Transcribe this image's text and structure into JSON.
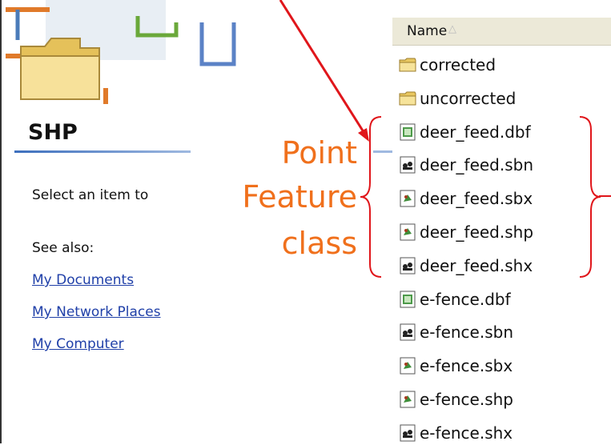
{
  "left": {
    "folder_title": "SHP",
    "select_text": "Select an item to",
    "see_also": "See also:",
    "links": [
      "My Documents",
      "My Network Places",
      "My Computer"
    ]
  },
  "list": {
    "column_name": "Name",
    "sort_icon": "sort-ascending-icon",
    "files": [
      {
        "name": "corrected",
        "icon": "folder-icon"
      },
      {
        "name": "uncorrected",
        "icon": "folder-icon"
      },
      {
        "name": "deer_feed.dbf",
        "icon": "dbf-file-icon"
      },
      {
        "name": "deer_feed.sbn",
        "icon": "sbn-file-icon"
      },
      {
        "name": "deer_feed.sbx",
        "icon": "sbx-file-icon"
      },
      {
        "name": "deer_feed.shp",
        "icon": "shp-file-icon"
      },
      {
        "name": "deer_feed.shx",
        "icon": "shx-file-icon"
      },
      {
        "name": "e-fence.dbf",
        "icon": "dbf-file-icon"
      },
      {
        "name": "e-fence.sbn",
        "icon": "sbn-file-icon"
      },
      {
        "name": "e-fence.sbx",
        "icon": "sbx-file-icon"
      },
      {
        "name": "e-fence.shp",
        "icon": "shp-file-icon"
      },
      {
        "name": "e-fence.shx",
        "icon": "shx-file-icon"
      }
    ]
  },
  "annotation": {
    "lines": [
      "Point",
      "Feature",
      "class"
    ],
    "color": "#f0701c"
  }
}
